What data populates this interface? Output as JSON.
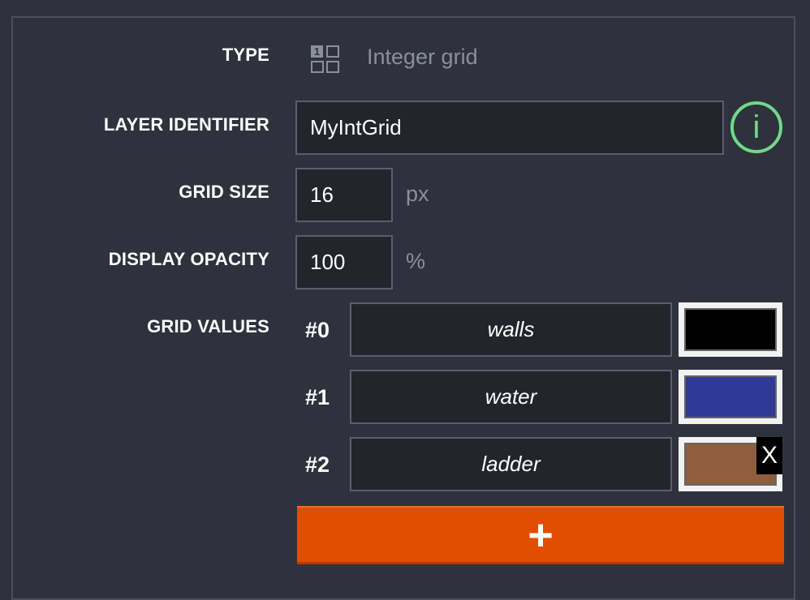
{
  "layer": {
    "type_label": "TYPE",
    "type_value": "Integer grid",
    "type_icon": "integer-grid-icon",
    "identifier_label": "LAYER IDENTIFIER",
    "identifier_value": "MyIntGrid",
    "info_icon_glyph": "i",
    "grid_size_label": "GRID SIZE",
    "grid_size_value": "16",
    "grid_size_unit": "px",
    "opacity_label": "DISPLAY OPACITY",
    "opacity_value": "100",
    "opacity_unit": "%",
    "grid_values_label": "GRID VALUES"
  },
  "grid_values": [
    {
      "index": "#0",
      "name": "walls",
      "color": "#000000"
    },
    {
      "index": "#1",
      "name": "water",
      "color": "#2f3a97"
    },
    {
      "index": "#2",
      "name": "ladder",
      "color": "#8e5e3f"
    }
  ],
  "remove_label": "X",
  "add_label": "+"
}
